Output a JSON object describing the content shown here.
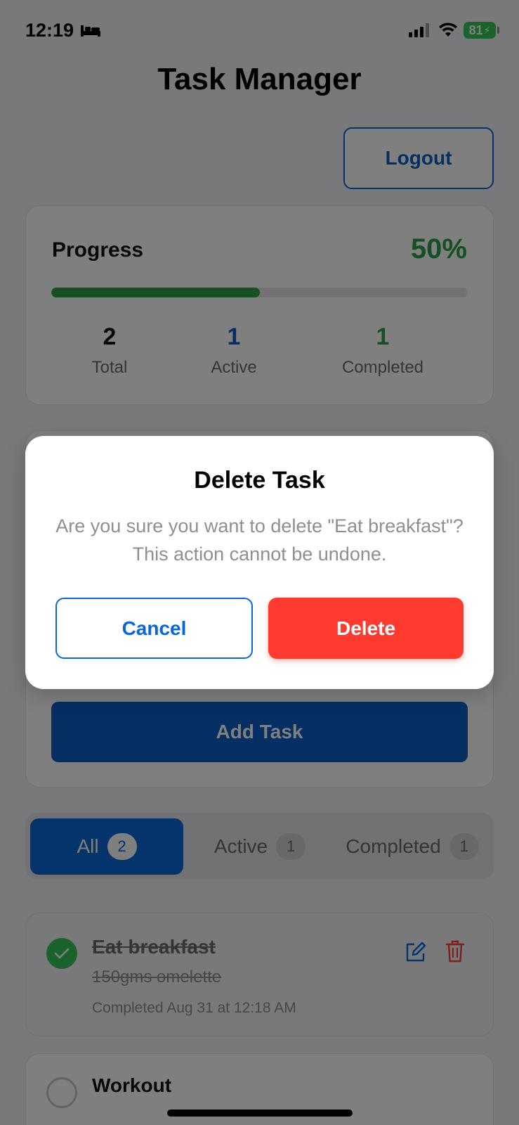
{
  "status_bar": {
    "time": "12:19",
    "battery": "81"
  },
  "app": {
    "title": "Task Manager",
    "logout_label": "Logout"
  },
  "progress": {
    "label": "Progress",
    "percent_text": "50%",
    "fraction": 0.5,
    "stats": [
      {
        "value": "2",
        "label": "Total",
        "color": "#111111"
      },
      {
        "value": "1",
        "label": "Active",
        "color": "#0a5cc7"
      },
      {
        "value": "1",
        "label": "Completed",
        "color": "#2e9e4a"
      }
    ]
  },
  "form": {
    "add_task_label": "Add Task"
  },
  "filters": [
    {
      "label": "All",
      "count": "2",
      "active": true
    },
    {
      "label": "Active",
      "count": "1",
      "active": false
    },
    {
      "label": "Completed",
      "count": "1",
      "active": false
    }
  ],
  "tasks": [
    {
      "title": "Eat breakfast",
      "description": "150gms omelette",
      "meta": "Completed Aug 31 at 12:18 AM",
      "completed": true
    },
    {
      "title": "Workout",
      "completed": false
    }
  ],
  "modal": {
    "title": "Delete Task",
    "message": "Are you sure you want to delete \"Eat breakfast\"? This action cannot be undone.",
    "cancel_label": "Cancel",
    "delete_label": "Delete"
  },
  "colors": {
    "primary": "#0a66d8",
    "success": "#34c759",
    "danger": "#ff3b30"
  },
  "icons": [
    "bed-icon",
    "signal-icon",
    "wifi-icon",
    "battery-icon",
    "check-icon",
    "edit-icon",
    "trash-icon"
  ]
}
